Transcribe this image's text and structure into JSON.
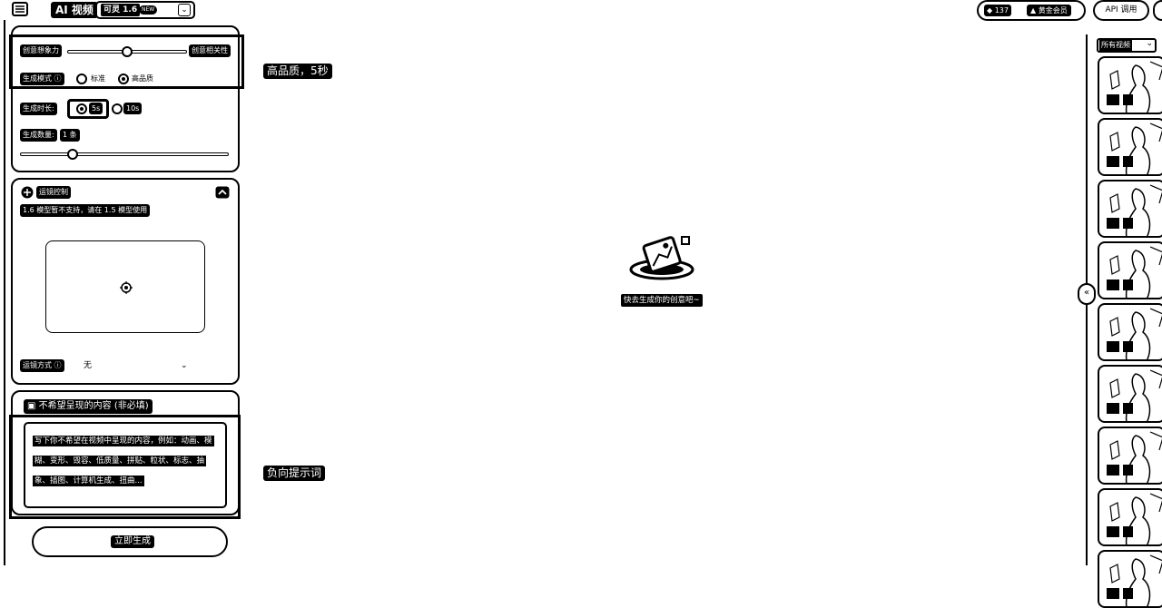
{
  "topbar": {
    "app_title": "AI 视频",
    "model": {
      "name": "可灵 1.6",
      "badge": "NEW"
    },
    "credits": "137",
    "vip_label": "黄金会员",
    "api_label": "API 调用"
  },
  "basic_settings": {
    "creativity_left": "创意想象力",
    "creativity_right": "创意相关性",
    "creativity_value": 0.5,
    "mode_label": "生成模式",
    "mode_options": [
      "标准",
      "高品质"
    ],
    "mode_selected": "高品质",
    "duration_label": "生成时长",
    "duration_options": [
      "5s",
      "10s"
    ],
    "duration_selected": "5s",
    "count_label": "生成数量",
    "count_value": "1 条",
    "count_fraction": 0.25
  },
  "camera_control": {
    "title": "运镜控制",
    "notice": "1.6 模型暂不支持，请在 1.5 模型使用",
    "method_label": "运镜方式",
    "method_value": "无"
  },
  "negative_prompt": {
    "title": "不希望呈现的内容",
    "optional": "(非必填)",
    "placeholder": "写下你不希望在视频中呈现的内容，例如：动画、模糊、变形、毁容、低质量、拼贴、粒状、标志、抽象、插图、计算机生成、扭曲..."
  },
  "generate_button": "立即生成",
  "annotations": {
    "quality": "高品质，5秒",
    "negative": "负向提示词"
  },
  "empty_state": {
    "text": "快去生成你的创意吧~"
  },
  "right_panel": {
    "filter_label": "所有视频",
    "thumbnails": [
      "1",
      "2",
      "3",
      "4",
      "5",
      "6",
      "7",
      "8",
      "9"
    ]
  }
}
